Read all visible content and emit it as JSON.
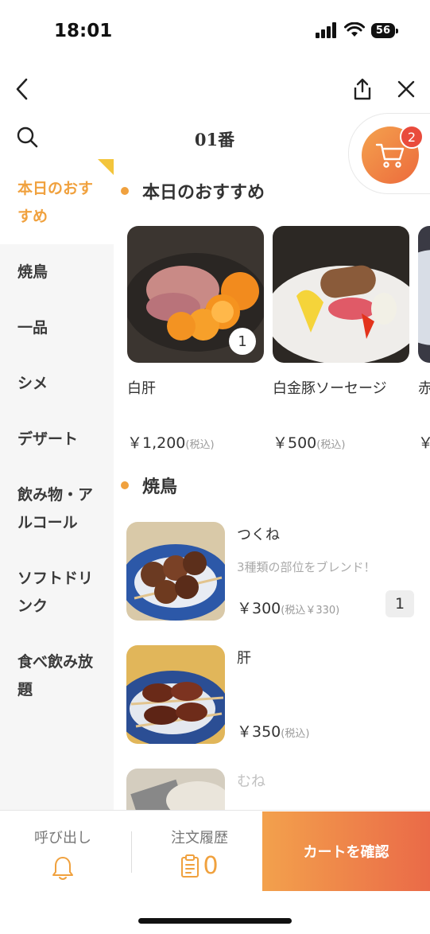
{
  "status": {
    "time": "18:01",
    "battery": "56"
  },
  "header": {
    "title": "01番"
  },
  "cart": {
    "count": "2"
  },
  "sidebar": {
    "items": [
      {
        "label": "本日のおすすめ"
      },
      {
        "label": "焼鳥"
      },
      {
        "label": "一品"
      },
      {
        "label": "シメ"
      },
      {
        "label": "デザート"
      },
      {
        "label": "飲み物・アルコール"
      },
      {
        "label": "ソフトドリンク"
      },
      {
        "label": "食べ飲み放題"
      }
    ]
  },
  "sections": {
    "recommend": {
      "title": "本日のおすすめ",
      "cards": [
        {
          "name": "白肝",
          "price": "￥1,200",
          "tax": "(税込)",
          "qty": "1"
        },
        {
          "name": "白金豚ソーセージ",
          "price": "￥500",
          "tax": "(税込)"
        },
        {
          "name": "赤",
          "price": "￥"
        }
      ]
    },
    "yakitori": {
      "title": "焼鳥",
      "items": [
        {
          "name": "つくね",
          "desc": "3種類の部位をブレンド！",
          "price": "￥300",
          "tax": "(税込￥330)",
          "qty": "1"
        },
        {
          "name": "肝",
          "price": "￥350",
          "tax": "(税込)"
        },
        {
          "name": "むね"
        }
      ]
    }
  },
  "bottom": {
    "call_label": "呼び出し",
    "history_label": "注文履歴",
    "history_count": "0",
    "confirm_label": "カートを確認"
  },
  "colors": {
    "accent": "#f0a13e",
    "cart_gradient_start": "#f3a14c",
    "cart_gradient_end": "#ea6a48",
    "badge": "#e94b3c"
  },
  "icons": [
    "back-icon",
    "share-icon",
    "close-icon",
    "search-icon",
    "cart-icon",
    "bell-icon",
    "clipboard-icon"
  ]
}
